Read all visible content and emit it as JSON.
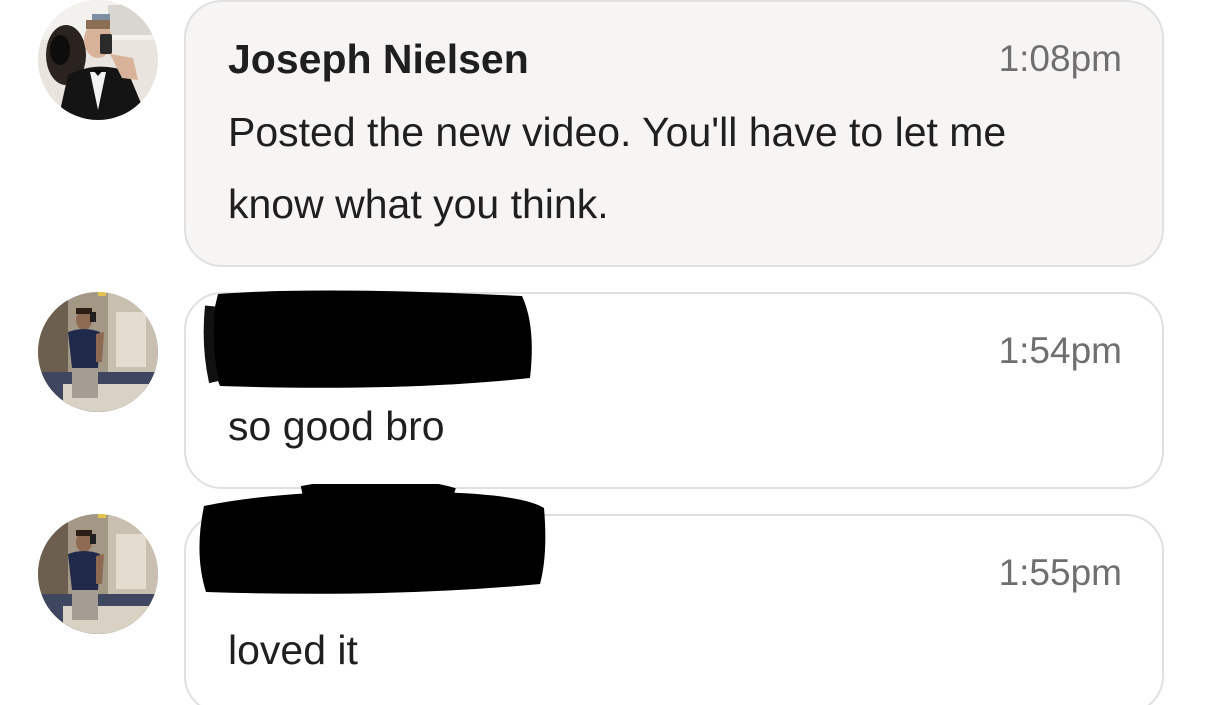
{
  "messages": [
    {
      "sender": "Joseph Nielsen",
      "time": "1:08pm",
      "text": "Posted the new video. You'll have to let me know what you think.",
      "avatar": "person-in-tuxedo-mirror-selfie"
    },
    {
      "sender": "",
      "sender_redacted": true,
      "time": "1:54pm",
      "text": "so good bro",
      "avatar": "person-in-blue-tshirt-mirror-selfie"
    },
    {
      "sender": "",
      "sender_redacted": true,
      "time": "1:55pm",
      "text": "loved it",
      "avatar": "person-in-blue-tshirt-mirror-selfie"
    }
  ],
  "colors": {
    "first_bubble_bg": "#f6f5f4",
    "bubble_border": "#e0e0e0",
    "text": "#1f1f1f",
    "timestamp": "#6f6f6f",
    "redaction": "#000000"
  }
}
